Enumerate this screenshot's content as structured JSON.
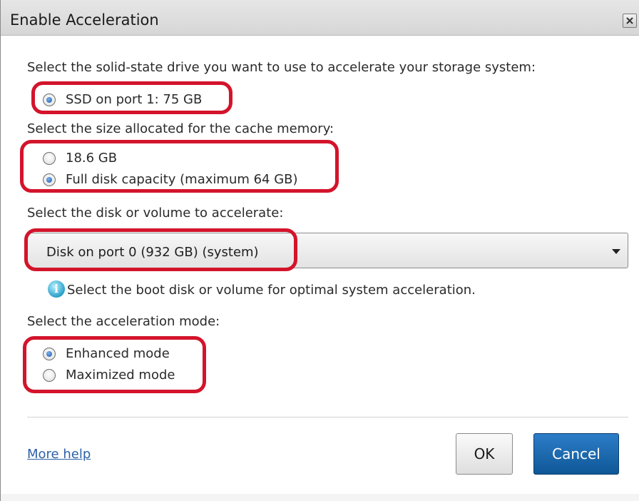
{
  "window": {
    "title": "Enable Acceleration"
  },
  "ssd": {
    "prompt": "Select the solid-state drive you want to use to accelerate your storage system:",
    "option": "SSD on port 1: 75 GB",
    "selected": true
  },
  "cache": {
    "prompt": "Select the size allocated for the cache memory:",
    "options": [
      {
        "label": "18.6 GB",
        "selected": false
      },
      {
        "label": "Full disk capacity (maximum 64 GB)",
        "selected": true
      }
    ]
  },
  "volume": {
    "prompt": "Select the disk or volume to accelerate:",
    "selected_value": "Disk on port 0 (932 GB) (system)",
    "hint": "Select the boot disk or volume for optimal system acceleration."
  },
  "mode": {
    "prompt": "Select the acceleration mode:",
    "options": [
      {
        "label": "Enhanced mode",
        "selected": true
      },
      {
        "label": "Maximized mode",
        "selected": false
      }
    ]
  },
  "footer": {
    "help_link": "More help",
    "ok_label": "OK",
    "cancel_label": "Cancel"
  },
  "colors": {
    "highlight": "#d3142b",
    "primary_button": "#1a66ad",
    "link": "#2e61a8"
  }
}
